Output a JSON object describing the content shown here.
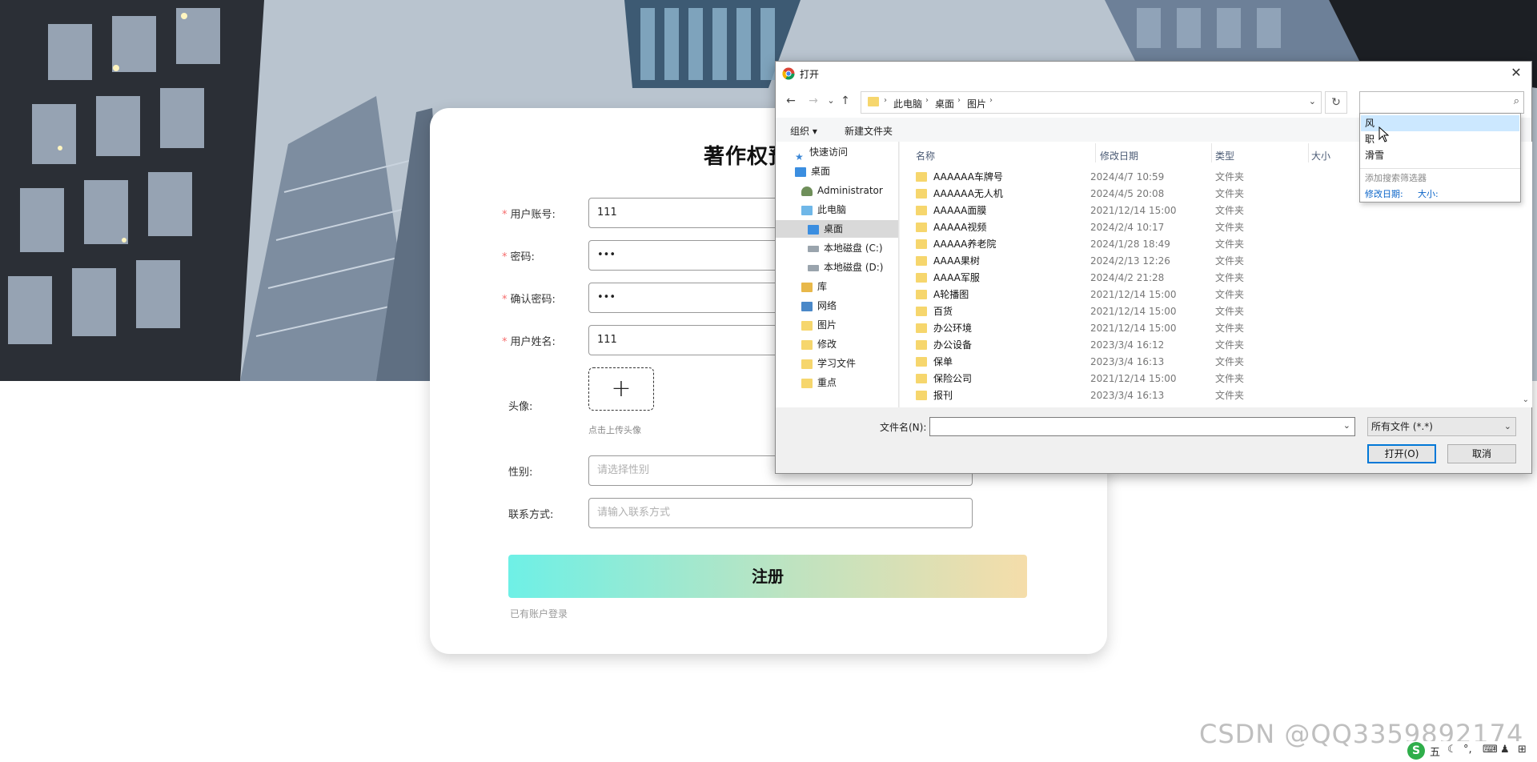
{
  "card": {
    "title": "著作权预约登",
    "fields": [
      {
        "label": "用户账号:",
        "value": "111",
        "required": true
      },
      {
        "label": "密码:",
        "value": "•••",
        "required": true
      },
      {
        "label": "确认密码:",
        "value": "•••",
        "required": true
      },
      {
        "label": "用户姓名:",
        "value": "111",
        "required": true
      }
    ],
    "avatar_label": "头像:",
    "avatar_plus": "+",
    "avatar_tip": "点击上传头像",
    "gender_label": "性别:",
    "gender_placeholder": "请选择性别",
    "contact_label": "联系方式:",
    "contact_placeholder": "请输入联系方式",
    "register_button": "注册",
    "login_link": "已有账户登录",
    "required_mark": "*"
  },
  "dialog": {
    "title": "打开",
    "close": "✕",
    "nav": {
      "back": "←",
      "forward": "→",
      "recent": "⌄",
      "up": "↑"
    },
    "breadcrumb": [
      "此电脑",
      "桌面",
      "图片"
    ],
    "crumb_sep": "›",
    "refresh": "↻",
    "search_value": "",
    "search_icon": "⌕",
    "toolbar": {
      "organize": "组织 ▾",
      "new_folder": "新建文件夹"
    },
    "nav_pane": [
      {
        "label": "快速访问",
        "icon": "star-icon"
      },
      {
        "label": "桌面",
        "icon": "desktop-icon"
      },
      {
        "label": "Administrator",
        "icon": "user-icon"
      },
      {
        "label": "此电脑",
        "icon": "pc-icon"
      },
      {
        "label": "桌面",
        "icon": "desktop-icon",
        "selected": true
      },
      {
        "label": "本地磁盘 (C:)",
        "icon": "drive-icon"
      },
      {
        "label": "本地磁盘 (D:)",
        "icon": "drive-icon"
      },
      {
        "label": "库",
        "icon": "library-icon"
      },
      {
        "label": "网络",
        "icon": "network-icon"
      },
      {
        "label": "图片",
        "icon": "folder-icon"
      },
      {
        "label": "修改",
        "icon": "folder-icon"
      },
      {
        "label": "学习文件",
        "icon": "folder-icon"
      },
      {
        "label": "重点",
        "icon": "folder-icon"
      }
    ],
    "columns": {
      "name": "名称",
      "date": "修改日期",
      "type": "类型",
      "size": "大小"
    },
    "files": [
      {
        "name": "AAAAAA车牌号",
        "date": "2024/4/7 10:59",
        "type": "文件夹"
      },
      {
        "name": "AAAAAA无人机",
        "date": "2024/4/5 20:08",
        "type": "文件夹"
      },
      {
        "name": "AAAAA面膜",
        "date": "2021/12/14 15:00",
        "type": "文件夹"
      },
      {
        "name": "AAAAA视频",
        "date": "2024/2/4 10:17",
        "type": "文件夹"
      },
      {
        "name": "AAAAA养老院",
        "date": "2024/1/28 18:49",
        "type": "文件夹"
      },
      {
        "name": "AAAA果树",
        "date": "2024/2/13 12:26",
        "type": "文件夹"
      },
      {
        "name": "AAAA军服",
        "date": "2024/4/2 21:28",
        "type": "文件夹"
      },
      {
        "name": "A轮播图",
        "date": "2021/12/14 15:00",
        "type": "文件夹"
      },
      {
        "name": "百货",
        "date": "2021/12/14 15:00",
        "type": "文件夹"
      },
      {
        "name": "办公环境",
        "date": "2021/12/14 15:00",
        "type": "文件夹"
      },
      {
        "name": "办公设备",
        "date": "2023/3/4 16:12",
        "type": "文件夹"
      },
      {
        "name": "保单",
        "date": "2023/3/4 16:13",
        "type": "文件夹"
      },
      {
        "name": "保险公司",
        "date": "2021/12/14 15:00",
        "type": "文件夹"
      },
      {
        "name": "报刊",
        "date": "2023/3/4 16:13",
        "type": "文件夹"
      }
    ],
    "filename_label": "文件名(N):",
    "filename_value": "",
    "filetype": "所有文件 (*.*)",
    "open_button": "打开(O)",
    "cancel_button": "取消",
    "dropdown_arrow": "⌄"
  },
  "search_suggest": {
    "items": [
      "风",
      "职",
      "滑雪"
    ],
    "add_filter": "添加搜索筛选器",
    "date_filter": "修改日期:",
    "size_filter": "大小:"
  },
  "watermark": "CSDN @QQ3359892174",
  "tray": {
    "ime": "S",
    "ime_mode": "五",
    "icons": [
      "moon-icon",
      "punct-icon",
      "keyboard-icon",
      "user-icon",
      "grid-icon"
    ]
  },
  "colors": {
    "accent": "#0078d7",
    "required": "#f56c6c",
    "folder": "#f6d66d",
    "link": "#0a64c8"
  }
}
